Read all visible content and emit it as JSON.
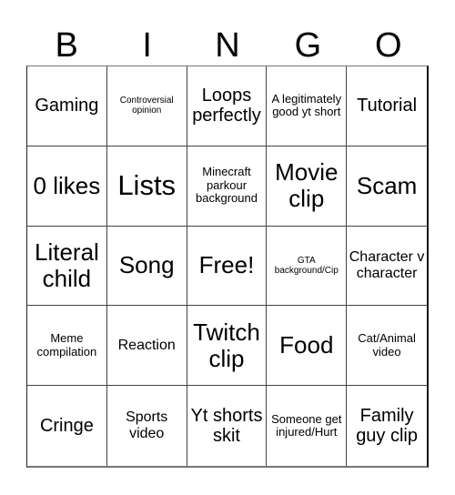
{
  "header": [
    "B",
    "I",
    "N",
    "G",
    "O"
  ],
  "cells": [
    {
      "text": "Gaming",
      "size": "s-lg"
    },
    {
      "text": "Controversial opinion",
      "size": "s-xs"
    },
    {
      "text": "Loops perfectly",
      "size": "s-lg"
    },
    {
      "text": "A legitimately good yt short",
      "size": "s-sm"
    },
    {
      "text": "Tutorial",
      "size": "s-lg"
    },
    {
      "text": "0 likes",
      "size": "s-xl"
    },
    {
      "text": "Lists",
      "size": "s-xxl"
    },
    {
      "text": "Minecraft parkour background",
      "size": "s-sm"
    },
    {
      "text": "Movie clip",
      "size": "s-xl"
    },
    {
      "text": "Scam",
      "size": "s-xl"
    },
    {
      "text": "Literal child",
      "size": "s-xl"
    },
    {
      "text": "Song",
      "size": "s-xl"
    },
    {
      "text": "Free!",
      "size": "s-xl"
    },
    {
      "text": "GTA background/Cip",
      "size": "s-xs"
    },
    {
      "text": "Character v character",
      "size": "s-md"
    },
    {
      "text": "Meme compilation",
      "size": "s-sm"
    },
    {
      "text": "Reaction",
      "size": "s-md"
    },
    {
      "text": "Twitch clip",
      "size": "s-xl"
    },
    {
      "text": "Food",
      "size": "s-xl"
    },
    {
      "text": "Cat/Animal video",
      "size": "s-sm"
    },
    {
      "text": "Cringe",
      "size": "s-lg"
    },
    {
      "text": "Sports video",
      "size": "s-md"
    },
    {
      "text": "Yt shorts skit",
      "size": "s-lg"
    },
    {
      "text": "Someone get injured/Hurt",
      "size": "s-sm"
    },
    {
      "text": "Family guy clip",
      "size": "s-lg"
    }
  ]
}
